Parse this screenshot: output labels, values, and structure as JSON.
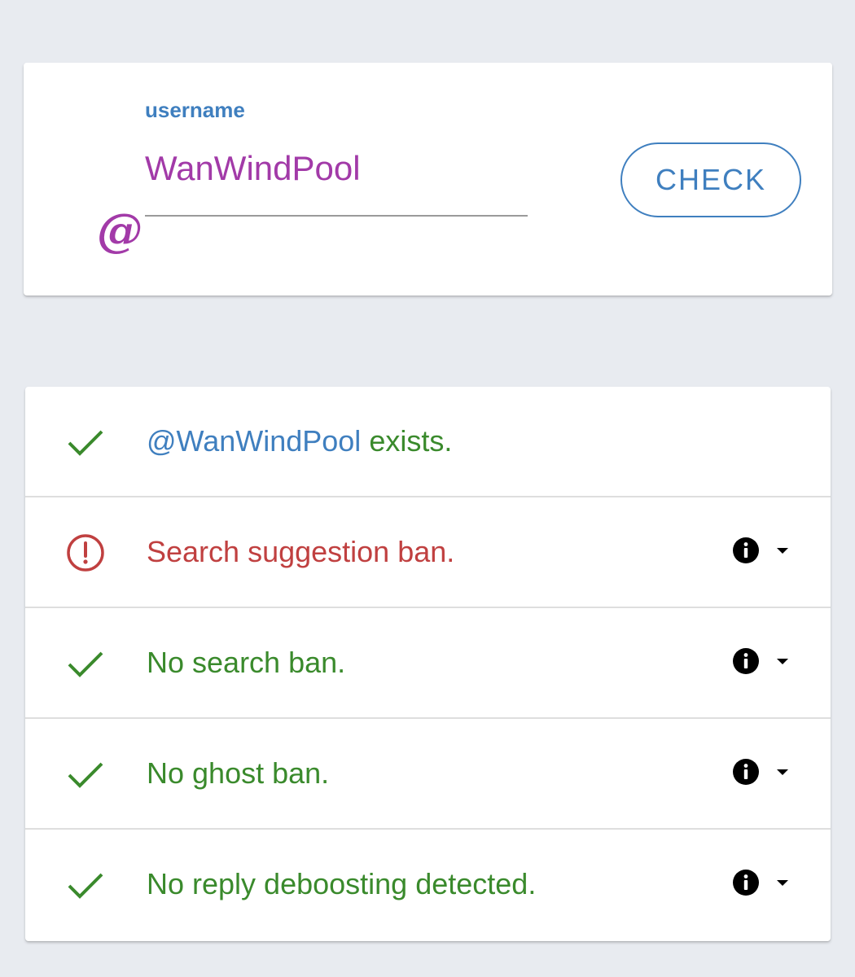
{
  "search": {
    "label": "username",
    "at_symbol": "@",
    "value": "WanWindPool",
    "button_label": "CHECK"
  },
  "results": [
    {
      "status": "ok",
      "icon": "check-icon",
      "handle": "@WanWindPool",
      "text": " exists.",
      "has_info": false
    },
    {
      "status": "bad",
      "icon": "alert-circle-icon",
      "text": "Search suggestion ban.",
      "has_info": true
    },
    {
      "status": "ok",
      "icon": "check-icon",
      "text": "No search ban.",
      "has_info": true
    },
    {
      "status": "ok",
      "icon": "check-icon",
      "text": "No ghost ban.",
      "has_info": true
    },
    {
      "status": "ok",
      "icon": "check-icon",
      "text": "No reply deboosting detected.",
      "has_info": true
    }
  ],
  "colors": {
    "accent_blue": "#3f7fbf",
    "accent_purple": "#a23aa8",
    "ok_green": "#3a8a2c",
    "error_red": "#c04040",
    "background": "#e8ebf0"
  }
}
